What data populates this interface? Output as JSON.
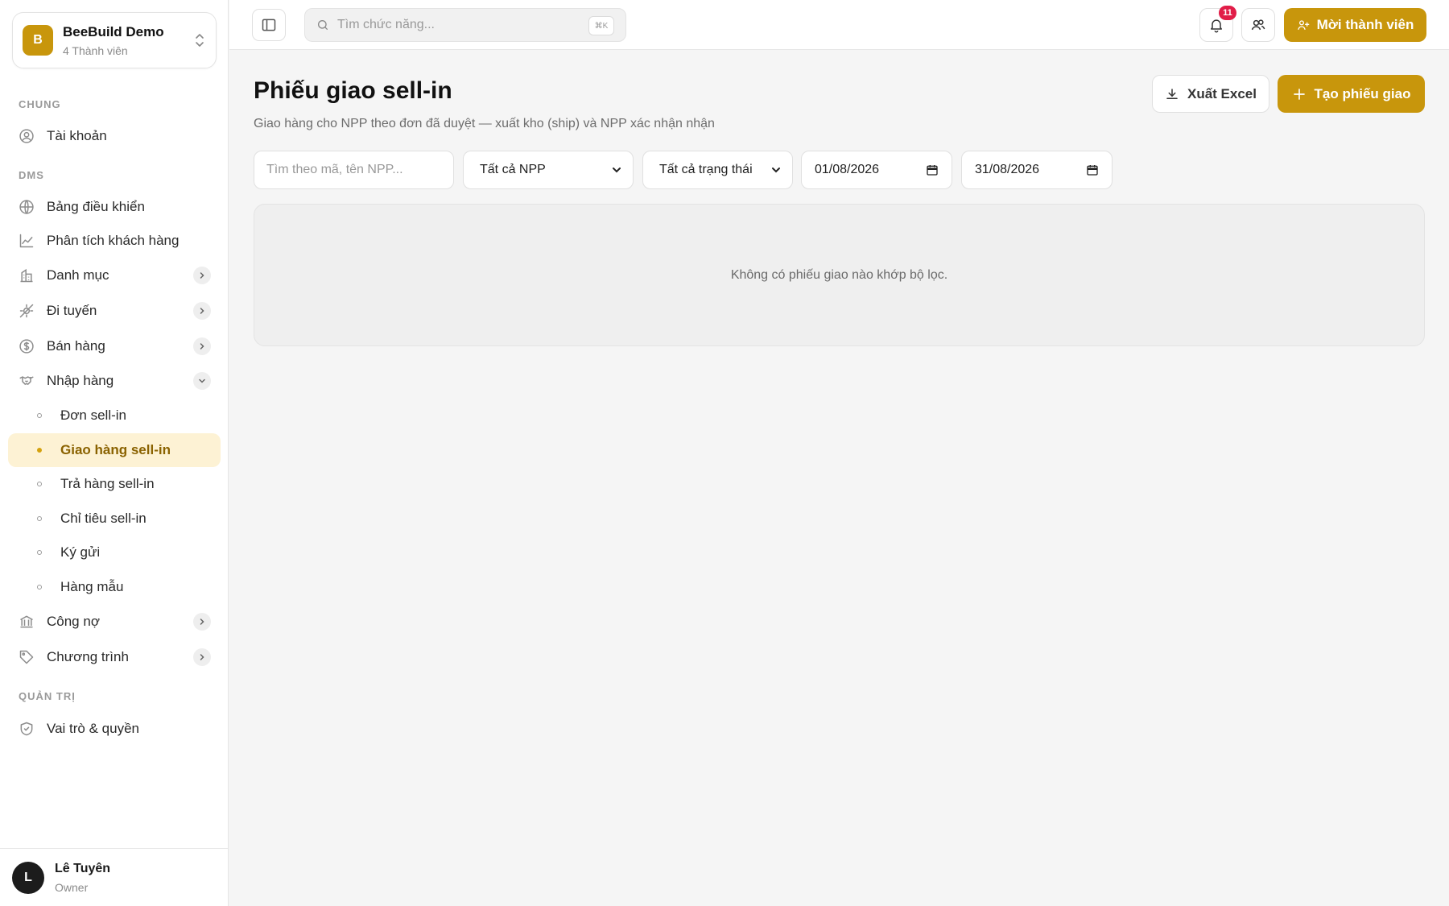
{
  "org": {
    "name": "BeeBuild Demo",
    "members": "4 Thành viên",
    "logo_letter": "B"
  },
  "sidebar": {
    "sections": {
      "general": "CHUNG",
      "dms": "DMS",
      "admin": "QUẢN TRỊ"
    },
    "items": {
      "account": "Tài khoản",
      "dashboard": "Bảng điều khiển",
      "customer_analytics": "Phân tích khách hàng",
      "catalog": "Danh mục",
      "routes": "Đi tuyến",
      "sales": "Bán hàng",
      "purchasing": "Nhập hàng",
      "debt": "Công nợ",
      "programs": "Chương trình",
      "roles": "Vai trò & quyền"
    },
    "purchasing_sub": {
      "orders": "Đơn sell-in",
      "delivery": "Giao hàng sell-in",
      "returns": "Trả hàng sell-in",
      "targets": "Chỉ tiêu sell-in",
      "consignment": "Ký gửi",
      "samples": "Hàng mẫu"
    }
  },
  "user": {
    "name": "Lê Tuyên",
    "role": "Owner",
    "initial": "L"
  },
  "topbar": {
    "search_placeholder": "Tìm chức năng...",
    "shortcut": "⌘K",
    "notification_count": "11",
    "invite_label": "Mời thành viên"
  },
  "page": {
    "title": "Phiếu giao sell-in",
    "subtitle": "Giao hàng cho NPP theo đơn đã duyệt — xuất kho (ship) và NPP xác nhận nhận",
    "export_label": "Xuất Excel",
    "create_label": "Tạo phiếu giao"
  },
  "filters": {
    "search_placeholder": "Tìm theo mã, tên NPP...",
    "distributor": "Tất cả NPP",
    "status": "Tất cả trạng thái",
    "date_from": "01/08/2026",
    "date_to": "31/08/2026"
  },
  "empty_message": "Không có phiếu giao nào khớp bộ lọc.",
  "colors": {
    "accent": "#c8960c",
    "active_bg": "#fdf2d4",
    "badge": "#e11d48"
  }
}
